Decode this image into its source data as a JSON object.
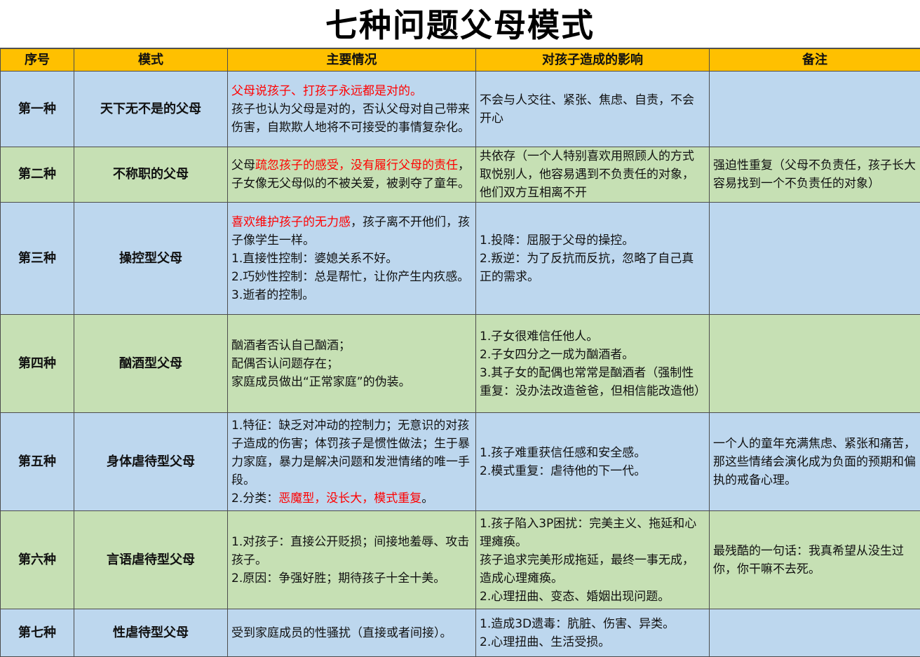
{
  "title": "七种问题父母模式",
  "headers": {
    "num": "序号",
    "mode": "模式",
    "situation": "主要情况",
    "impact": "对孩子造成的影响",
    "note": "备注"
  },
  "rows": [
    {
      "num": "第一种",
      "mode": "天下无不是的父母",
      "situation": {
        "red_line": "父母说孩子、打孩子永远都是对的。",
        "text": "孩子也认为父母是对的，否认父母对自己带来伤害，自欺欺人地将不可接受的事情复杂化。"
      },
      "impact": "不会与人交往、紧张、焦虑、自责，不会开心",
      "note": ""
    },
    {
      "num": "第二种",
      "mode": "不称职的父母",
      "situation": {
        "prefix": "父母",
        "red": "疏忽孩子的感受，没有履行父母的责任",
        "suffix": "，子女像无父母似的不被关爱，被剥夺了童年。"
      },
      "impact": "共依存（一个人特别喜欢用照顾人的方式取悦别人，他容易遇到不负责任的对象，他们双方互相离不开",
      "note": "强迫性重复（父母不负责任，孩子长大容易找到一个不负责任的对象）"
    },
    {
      "num": "第三种",
      "mode": "操控型父母",
      "situation": {
        "red": "喜欢维护孩子的无力感",
        "suffix": "，孩子离不开他们，孩子像学生一样。",
        "l1": "1.直接性控制：婆媳关系不好。",
        "l2": "2.巧妙性控制：总是帮忙，让你产生内疚感。",
        "l3": "3.逝者的控制。"
      },
      "impact": {
        "l1": "1.投降：屈服于父母的操控。",
        "l2": "2.叛逆：为了反抗而反抗，忽略了自己真正的需求。"
      },
      "note": ""
    },
    {
      "num": "第四种",
      "mode": "酗酒型父母",
      "situation": {
        "l1": "酗酒者否认自己酗酒；",
        "l2": "配偶否认问题存在；",
        "l3": "家庭成员做出“正常家庭”的伪装。"
      },
      "impact": {
        "l1": "1.子女很难信任他人。",
        "l2": "2.子女四分之一成为酗酒者。",
        "l3": "3.其子女的配偶也常常是酗酒者（强制性重复：没办法改造爸爸，但相信能改造他）"
      },
      "note": ""
    },
    {
      "num": "第五种",
      "mode": "身体虐待型父母",
      "situation": {
        "l1": "1.特征：缺乏对冲动的控制力；无意识的对孩子造成的伤害；体罚孩子是惯性做法；生于暴力家庭，暴力是解决问题和发泄情绪的唯一手段。",
        "l2_prefix": "2.分类：",
        "l2_red": "恶魔型，没长大，模式重复",
        "l2_suffix": "。"
      },
      "impact": {
        "l1": "1.孩子难重获信任感和安全感。",
        "l2": "2.模式重复：虐待他的下一代。"
      },
      "note": "一个人的童年充满焦虑、紧张和痛苦，那这些情绪会演化成为负面的预期和偏执的戒备心理。"
    },
    {
      "num": "第六种",
      "mode": "言语虐待型父母",
      "situation": {
        "l1": "1.对孩子：直接公开贬损；间接地羞辱、攻击孩子。",
        "l2": "2.原因：争强好胜；期待孩子十全十美。"
      },
      "impact": {
        "l1": "1.孩子陷入3P困扰：完美主义、拖延和心理瘫痪。",
        "l2": "孩子追求完美形成拖延，最终一事无成，造成心理瘫痪。",
        "l3": "2.心理扭曲、变态、婚姻出现问题。"
      },
      "note": "最残酷的一句话：我真希望从没生过你，你干嘛不去死。"
    },
    {
      "num": "第七种",
      "mode": "性虐待型父母",
      "situation": "受到家庭成员的性骚扰（直接或者间接）。",
      "impact": {
        "l1": "1.造成3D遗毒：肮脏、伤害、异类。",
        "l2": "2.心理扭曲、生活受损。"
      },
      "note": ""
    }
  ]
}
